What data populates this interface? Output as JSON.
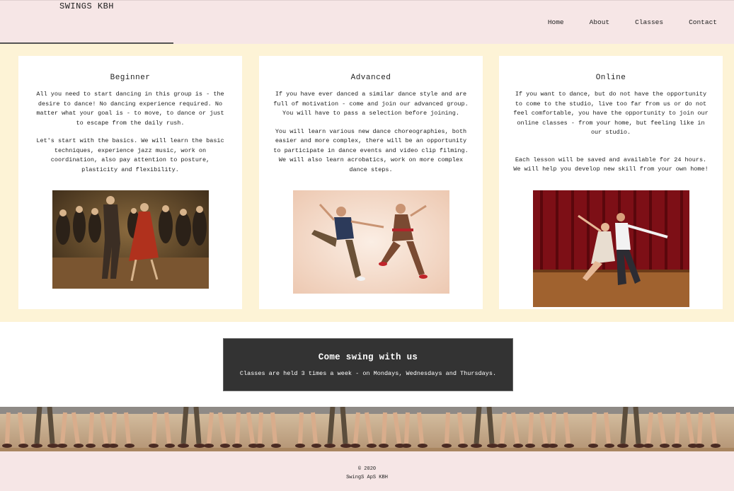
{
  "header": {
    "brand": "SWINGS KBH",
    "nav": [
      "Home",
      "About",
      "Classes",
      "Contact"
    ]
  },
  "cards": [
    {
      "title": "Beginner",
      "p1": "All you need to start dancing in this group is - the desire to dance! No dancing experience required. No matter what your goal is - to move, to dance or just to escape from the daily rush.",
      "p2": "Let's start with the basics. We will learn the basic techniques, experience jazz music, work on coordination, also pay attention to posture, plasticity and flexibility.",
      "image": "crowd-dancing-photo"
    },
    {
      "title": "Advanced",
      "p1": "If you have ever danced a similar dance style and are full of motivation - come and join our advanced group. You will have to pass a selection before joining.",
      "p2": "You will learn various new dance choreographies, both easier and more complex, there will be an opportunity to participate in dance events and video clip filming. We will also learn acrobatics, work on more complex dance steps.",
      "image": "couple-kicking-photo"
    },
    {
      "title": "Online",
      "p1": "If you want to dance, but do not have the opportunity to come to the studio, live too far from us or do not feel comfortable, you have the opportunity to join our online classes - from your home, but feeling like in our studio.",
      "p2": "Each lesson will be saved and available for 24 hours. We will help you develop new skill from your own home!",
      "image": "stage-couple-photo"
    }
  ],
  "cta": {
    "title": "Come swing with us",
    "text": "Classes are held 3 times a week - on Mondays, Wednesdays and Thursdays."
  },
  "banner": {
    "image": "dancers-legs-banner"
  },
  "footer": {
    "copyright": "© 2020",
    "company": "SwingS ApS KBH"
  },
  "colors": {
    "header_bg": "#f6e6e6",
    "cards_bg": "#fdf3d6",
    "cta_bg": "#333333"
  }
}
